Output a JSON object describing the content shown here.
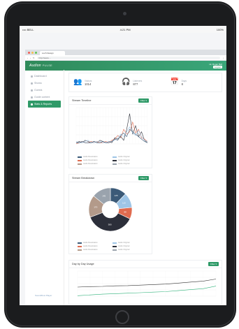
{
  "status": {
    "carrier": "•••• BELL",
    "time": "4:21 PM",
    "battery": "100%"
  },
  "browser": {
    "tab_title": "Loch Design",
    "url": "http://www.…"
  },
  "app": {
    "logo": "Audion",
    "logo_sub": "PULSE",
    "user_line": "Hi, Roger Bell",
    "user_button": "Logout"
  },
  "nav": [
    {
      "label": "Dashboard",
      "icon": "home-icon"
    },
    {
      "label": "Shows",
      "icon": "mic-icon"
    },
    {
      "label": "Guests",
      "icon": "people-icon"
    },
    {
      "label": "Guide content",
      "icon": "document-icon"
    },
    {
      "label": "Stats & Reports",
      "icon": "chart-icon",
      "active": true
    }
  ],
  "sidebar_footer": "SoundFlow Player",
  "stats": [
    {
      "label": "Visitors",
      "value": "1014",
      "icon": "users-icon"
    },
    {
      "label": "Listeners",
      "value": "877",
      "icon": "headphones-icon"
    },
    {
      "label": "Days",
      "value": "8",
      "icon": "calendar-icon"
    }
  ],
  "stream_timeline": {
    "title": "Stream Timeline",
    "button": "Filter ▾"
  },
  "stream_breakdown": {
    "title": "Stream Breakdown",
    "button": "Filter ▾"
  },
  "day_usage": {
    "title": "Day by Day Usage",
    "button": "Filter ▾"
  },
  "legend": [
    {
      "label": "Audio Restoration",
      "color": "#3b5a78"
    },
    {
      "label": "Audio Original",
      "color": "#9ec5e6"
    },
    {
      "label": "Audio Restoration",
      "color": "#e06b4f"
    },
    {
      "label": "Audio Original",
      "color": "#2c2f3a"
    },
    {
      "label": "Audio Restoration",
      "color": "#b39a8a"
    },
    {
      "label": "Audio Original",
      "color": "#9aa3ad"
    }
  ],
  "chart_data": [
    {
      "type": "line",
      "title": "Stream Timeline",
      "x": [
        1,
        2,
        3,
        4,
        5,
        6,
        7,
        8,
        9,
        10,
        11,
        12,
        13,
        14,
        15,
        16,
        17,
        18,
        19,
        20,
        21,
        22,
        23,
        24,
        25
      ],
      "ylim": [
        0,
        30
      ],
      "series": [
        {
          "color": "#2c2f3a",
          "values": [
            1,
            2,
            1,
            3,
            2,
            1,
            2,
            1,
            3,
            2,
            1,
            2,
            1,
            5,
            4,
            6,
            3,
            12,
            25,
            8,
            15,
            6,
            10,
            3,
            1
          ]
        },
        {
          "color": "#e06b4f",
          "values": [
            0,
            1,
            2,
            1,
            1,
            2,
            1,
            2,
            1,
            1,
            2,
            1,
            3,
            4,
            7,
            5,
            12,
            8,
            10,
            18,
            9,
            12,
            5,
            4,
            2
          ]
        },
        {
          "color": "#9ec5e6",
          "values": [
            2,
            1,
            1,
            2,
            3,
            1,
            1,
            2,
            2,
            1,
            1,
            2,
            2,
            3,
            5,
            8,
            6,
            10,
            14,
            9,
            7,
            11,
            6,
            3,
            2
          ]
        },
        {
          "color": "#3b5a78",
          "values": [
            1,
            1,
            2,
            1,
            1,
            1,
            2,
            1,
            1,
            2,
            1,
            1,
            2,
            4,
            3,
            7,
            9,
            6,
            12,
            10,
            8,
            6,
            4,
            2,
            1
          ]
        }
      ]
    },
    {
      "type": "pie",
      "title": "Stream Breakdown",
      "categories": [
        "Audio Restoration",
        "Audio Original",
        "Audio Restoration",
        "Audio Original",
        "Audio Restoration",
        "Audio Original"
      ],
      "values": [
        125,
        115,
        88,
        380,
        170,
        145
      ],
      "colors": [
        "#3b5a78",
        "#9ec5e6",
        "#e06b4f",
        "#2c2f3a",
        "#b39a8a",
        "#9aa3ad"
      ]
    },
    {
      "type": "line",
      "title": "Day by Day Usage",
      "x": [
        1,
        2,
        3,
        4,
        5,
        6,
        7,
        8,
        9,
        10,
        11,
        12
      ],
      "ylim": [
        0,
        100
      ],
      "series": [
        {
          "color": "#333333",
          "values": [
            36,
            38,
            39,
            41,
            42,
            44,
            46,
            48,
            52,
            56,
            60,
            68
          ]
        },
        {
          "color": "#2fb27a",
          "values": [
            2,
            5,
            8,
            10,
            12,
            14,
            16,
            18,
            22,
            26,
            30,
            40
          ]
        }
      ]
    }
  ]
}
